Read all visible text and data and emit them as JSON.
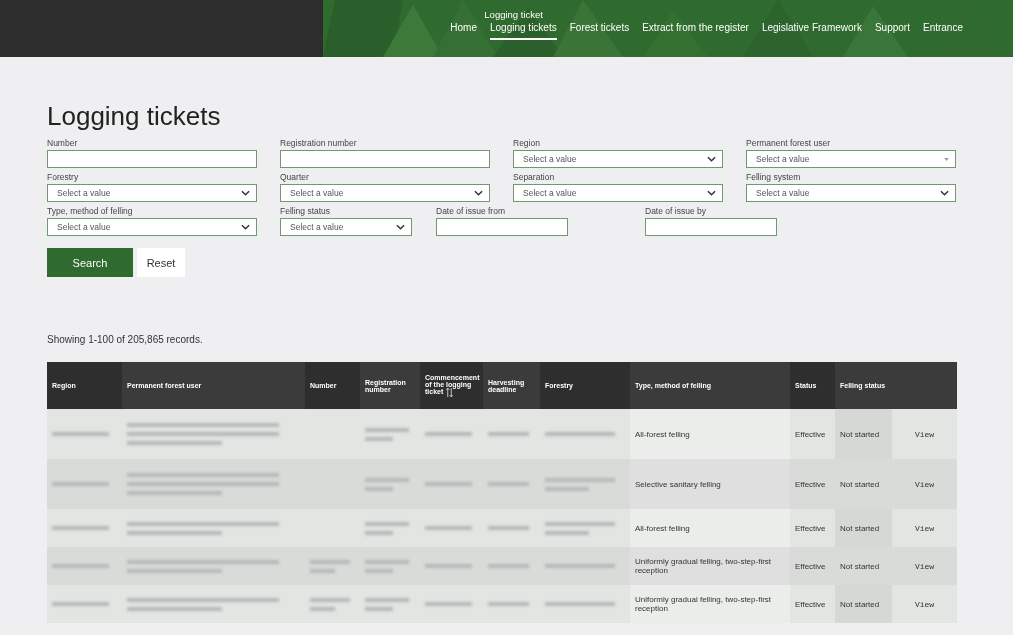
{
  "nav": {
    "hover_label": "Logging ticket",
    "items": [
      {
        "label": "Home",
        "selected": false
      },
      {
        "label": "Logging tickets",
        "selected": true
      },
      {
        "label": "Forest tickets",
        "selected": false
      },
      {
        "label": "Extract from the register",
        "selected": false
      },
      {
        "label": "Legislative Framework",
        "selected": false
      },
      {
        "label": "Support",
        "selected": false
      },
      {
        "label": "Entrance",
        "selected": false
      }
    ]
  },
  "title": "Logging tickets",
  "filters": [
    {
      "label": "Number",
      "kind": "text"
    },
    {
      "label": "Registration number",
      "kind": "text"
    },
    {
      "label": "Region",
      "kind": "select",
      "placeholder": "Select a value"
    },
    {
      "label": "Permanent forest user",
      "kind": "combo",
      "placeholder": "Select a value"
    },
    {
      "label": "Forestry",
      "kind": "select",
      "placeholder": "Select a value"
    },
    {
      "label": "Quarter",
      "kind": "select",
      "placeholder": "Select a value"
    },
    {
      "label": "Separation",
      "kind": "select",
      "placeholder": "Select a value"
    },
    {
      "label": "Felling system",
      "kind": "select",
      "placeholder": "Select a value"
    },
    {
      "label": "Type, method of felling",
      "kind": "select",
      "placeholder": "Select a value"
    },
    {
      "label": "Felling status",
      "kind": "select",
      "placeholder": "Select a value"
    },
    {
      "label": "Date of issue from",
      "kind": "text"
    },
    {
      "label": "Date of issue by",
      "kind": "text"
    }
  ],
  "buttons": {
    "search": "Search",
    "reset": "Reset"
  },
  "summary": "Showing 1-100 of 205,865 records.",
  "table": {
    "columns": [
      {
        "label": "Region",
        "sortable": false
      },
      {
        "label": "Permanent forest user",
        "sortable": false
      },
      {
        "label": "Number",
        "sortable": false
      },
      {
        "label": "Registration number",
        "sortable": false
      },
      {
        "label": "Commencement of the logging ticket",
        "sortable": true
      },
      {
        "label": "Harvesting deadline",
        "sortable": false
      },
      {
        "label": "Forestry",
        "sortable": false
      },
      {
        "label": "Type, method of felling",
        "sortable": false
      },
      {
        "label": "Status",
        "sortable": false
      },
      {
        "label": "Felling status",
        "sortable": false
      }
    ],
    "rows": [
      {
        "redacted": true,
        "type_method": "All-forest felling",
        "status": "Effective",
        "felling_status": "Not started",
        "action": "View"
      },
      {
        "redacted": true,
        "type_method": "Selective sanitary felling",
        "status": "Effective",
        "felling_status": "Not started",
        "action": "View"
      },
      {
        "redacted": true,
        "type_method": "All-forest felling",
        "status": "Effective",
        "felling_status": "Not started",
        "action": "View"
      },
      {
        "redacted": true,
        "type_method": "Uniformly gradual felling, two-step-first reception",
        "status": "Effective",
        "felling_status": "Not started",
        "action": "View"
      },
      {
        "redacted": true,
        "type_method": "Uniformly gradual felling, two-step-first reception",
        "status": "Effective",
        "felling_status": "Not started",
        "action": "View"
      }
    ]
  }
}
